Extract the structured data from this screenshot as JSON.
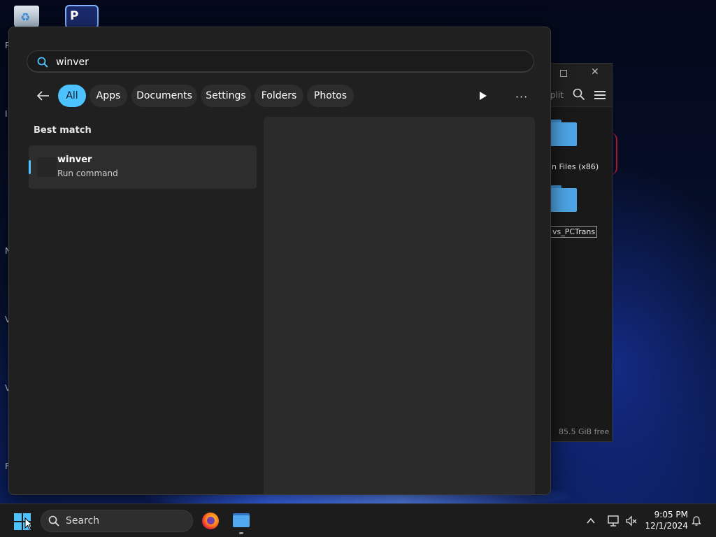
{
  "desktop": {
    "edge_letters": [
      "R",
      "I",
      "N",
      "V",
      "V",
      "F"
    ]
  },
  "explorer": {
    "toolbar_label": "plit",
    "folders": [
      {
        "label": "n Files (x86)"
      },
      {
        "label": "vs_PCTrans"
      }
    ],
    "status": "85.5 GiB free"
  },
  "search": {
    "query": "winver",
    "filters": [
      {
        "label": "All",
        "active": true
      },
      {
        "label": "Apps",
        "active": false
      },
      {
        "label": "Documents",
        "active": false
      },
      {
        "label": "Settings",
        "active": false
      },
      {
        "label": "Folders",
        "active": false
      },
      {
        "label": "Photos",
        "active": false
      }
    ],
    "more_label": "···",
    "best_match_title": "Best match",
    "best_match": {
      "title": "winver",
      "subtitle": "Run command"
    }
  },
  "taskbar": {
    "search_label": "Search",
    "time": "9:05 PM",
    "date": "12/1/2024"
  },
  "colors": {
    "accent": "#4cc2ff",
    "flyout_bg": "#202020",
    "taskbar_bg": "#1c1c1c"
  },
  "icons": {
    "start": "windows-start-icon",
    "search": "magnifier-icon",
    "browser": "firefox-icon",
    "file_manager": "folder-icon",
    "tray": [
      "chevron-up-icon",
      "network-icon",
      "volume-muted-icon",
      "notification-bell-icon"
    ]
  }
}
